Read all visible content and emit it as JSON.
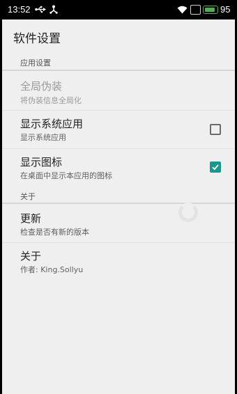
{
  "status_bar": {
    "time": "13:52",
    "battery_level": "95",
    "icons": [
      "usb-icon",
      "fork-icon",
      "wifi-icon",
      "sim-icon",
      "battery-icon"
    ],
    "battery_color": "#4caf50"
  },
  "app": {
    "title": "软件设置"
  },
  "sections": {
    "app_settings": {
      "header": "应用设置",
      "global_disguise": {
        "title": "全局伪装",
        "summary": "将伪装信息全局化",
        "enabled": false
      },
      "show_system_apps": {
        "title": "显示系统应用",
        "summary": "显示系统应用",
        "checked": false
      },
      "show_icon": {
        "title": "显示图标",
        "summary": "在桌面中显示本应用的图标",
        "checked": true
      }
    },
    "about": {
      "header": "关于",
      "update": {
        "title": "更新",
        "summary": "检查是否有新的版本"
      },
      "about_item": {
        "title": "关于",
        "summary": "作者: King.Sollyu"
      }
    }
  },
  "colors": {
    "accent": "#16998a",
    "background": "#efefef"
  }
}
